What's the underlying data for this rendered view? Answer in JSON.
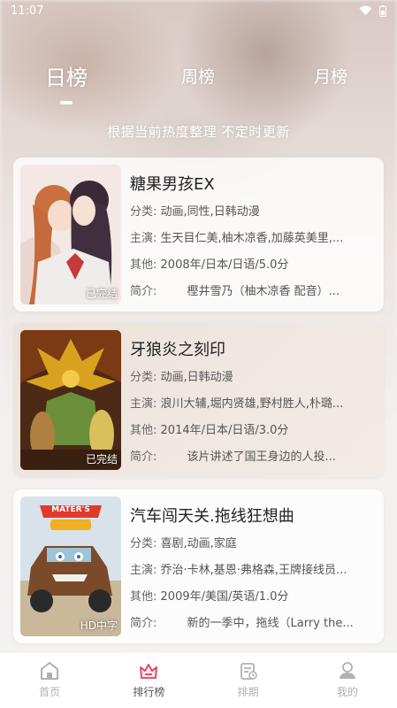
{
  "status_bar": {
    "time": "11:07"
  },
  "tabs": [
    {
      "label": "日榜",
      "active": true
    },
    {
      "label": "周榜",
      "active": false
    },
    {
      "label": "月榜",
      "active": false
    }
  ],
  "subtitle": "根据当前热度整理 不定时更新",
  "cards": [
    {
      "title": "糖果男孩EX",
      "badge": "已完结",
      "category_label": "分类:",
      "category": "动画,同性,日韩动漫",
      "cast_label": "主演:",
      "cast": "生天目仁美,柚木凉香,加藤英美里,...",
      "other_label": "其他:",
      "other": "2008年/日本/日语/5.0分",
      "intro_label": "简介:",
      "intro": "樫井雪乃（柚木凉香 配音）..."
    },
    {
      "title": "牙狼炎之刻印",
      "badge": "已完结",
      "category_label": "分类:",
      "category": "动画,日韩动漫",
      "cast_label": "主演:",
      "cast": "浪川大辅,堀内贤雄,野村胜人,朴璐...",
      "other_label": "其他:",
      "other": "2014年/日本/日语/3.0分",
      "intro_label": "简介:",
      "intro": "该片讲述了国王身边的人投..."
    },
    {
      "title": "汽车闯天关.拖线狂想曲",
      "badge": "HD中字",
      "poster_text": "MATER'S",
      "category_label": "分类:",
      "category": "喜剧,动画,家庭",
      "cast_label": "主演:",
      "cast": "乔治·卡林,基恩·弗格森,王牌接线员...",
      "other_label": "其他:",
      "other": "2009年/美国/英语/1.0分",
      "intro_label": "简介:",
      "intro": "新的一季中，拖线（Larry the..."
    }
  ],
  "bottom_nav": [
    {
      "label": "首页",
      "icon": "home-icon",
      "active": false
    },
    {
      "label": "排行榜",
      "icon": "ranking-icon",
      "active": true
    },
    {
      "label": "排期",
      "icon": "schedule-icon",
      "active": false
    },
    {
      "label": "我的",
      "icon": "profile-icon",
      "active": false
    }
  ],
  "colors": {
    "accent": "#e0405a",
    "nav_inactive": "#b0b0b0",
    "nav_active": "#555555"
  }
}
